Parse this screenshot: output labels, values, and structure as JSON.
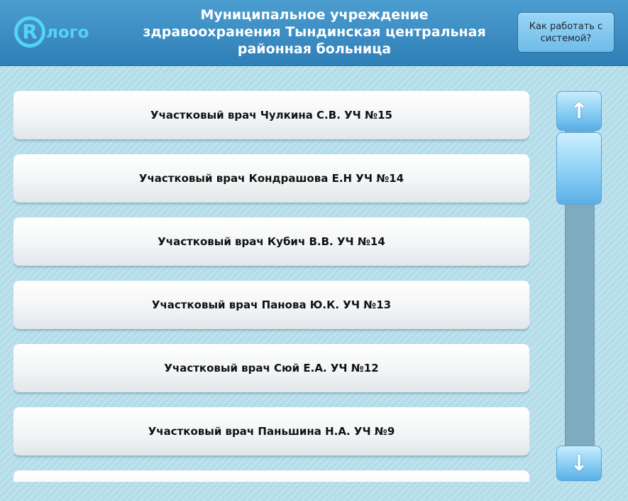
{
  "header": {
    "logo_letter": "R",
    "logo_text": "лого",
    "title_lines": [
      "Муниципальное учреждение",
      "здравоохранения Тындинская центральная",
      "районная больница"
    ],
    "help_button": "Как работать с системой?"
  },
  "doctors": [
    "Участковый врач Чулкина С.В. УЧ №15",
    "Участковый врач Кондрашова Е.Н УЧ №14",
    "Участковый врач Кубич В.В. УЧ №14",
    "Участковый врач Панова Ю.К. УЧ №13",
    "Участковый врач Сюй Е.А. УЧ №12",
    "Участковый врач Паньшина Н.А. УЧ №9",
    ""
  ],
  "scrollbar": {
    "up_glyph": "↑",
    "down_glyph": "↓"
  },
  "colors": {
    "header_bg": "#3a8cc4",
    "logo": "#56d2f5",
    "page_bg": "#b3dde9",
    "scroll_track": "#7eabbf",
    "scroll_button": "#88cdf4"
  }
}
